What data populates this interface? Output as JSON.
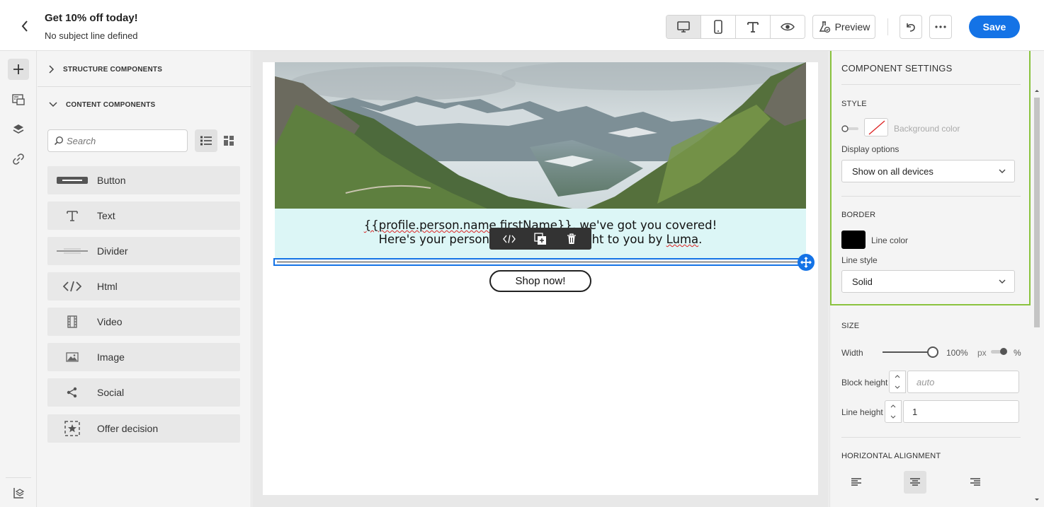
{
  "header": {
    "title": "Get 10% off today!",
    "subtitle": "No subject line defined",
    "preview_label": "Preview",
    "save_label": "Save"
  },
  "left_panel": {
    "structure_label": "STRUCTURE COMPONENTS",
    "content_label": "CONTENT COMPONENTS",
    "search_placeholder": "Search",
    "components": [
      {
        "label": "Button",
        "icon": "button-icon"
      },
      {
        "label": "Text",
        "icon": "text-icon"
      },
      {
        "label": "Divider",
        "icon": "divider-icon"
      },
      {
        "label": "Html",
        "icon": "html-icon"
      },
      {
        "label": "Video",
        "icon": "video-icon"
      },
      {
        "label": "Image",
        "icon": "image-icon"
      },
      {
        "label": "Social",
        "icon": "social-icon"
      },
      {
        "label": "Offer decision",
        "icon": "offer-decision-icon"
      }
    ]
  },
  "email": {
    "line1_a": "{{profile.person.name.firstName}}",
    "line1_b": ", we've got you covered!",
    "line2_a": "Here's your persona",
    "line2_b": "ght to you by ",
    "line2_c": "Luma",
    "line2_d": ".",
    "cta_label": "Shop now!"
  },
  "settings": {
    "title": "COMPONENT SETTINGS",
    "style_label": "STYLE",
    "background_color_label": "Background color",
    "display_options_label": "Display options",
    "display_options_value": "Show on all devices",
    "border_label": "BORDER",
    "line_color_label": "Line color",
    "line_color": "#000000",
    "line_style_label": "Line style",
    "line_style_value": "Solid",
    "size_label": "SIZE",
    "width_label": "Width",
    "width_value": "100%",
    "width_percent": 100,
    "unit_px": "px",
    "unit_pct": "%",
    "block_height_label": "Block height",
    "block_height_placeholder": "auto",
    "line_height_label": "Line height",
    "line_height_value": "1",
    "horizontal_alignment_label": "HORIZONTAL ALIGNMENT"
  },
  "colors": {
    "accent": "#1473e6",
    "highlight": "#8ac33e",
    "text_block_bg": "#dcf6f6"
  }
}
